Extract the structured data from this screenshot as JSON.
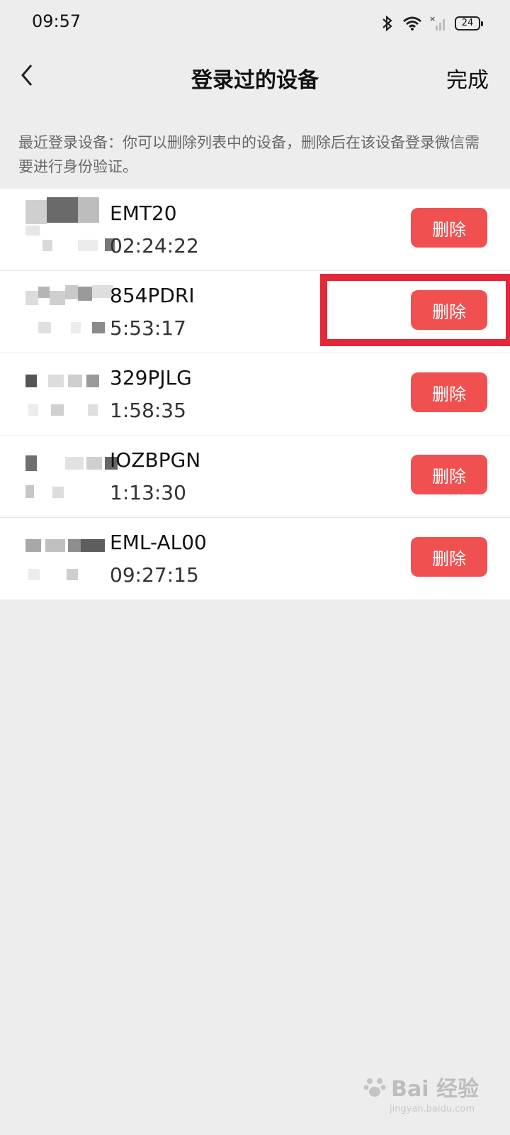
{
  "status_bar": {
    "time": "09:57",
    "battery": "24",
    "icons": [
      "bluetooth-icon",
      "wifi-icon",
      "cellular-signal-icon",
      "battery-icon"
    ]
  },
  "nav": {
    "back_icon": "chevron-left-icon",
    "title": "登录过的设备",
    "done_label": "完成"
  },
  "hint": "最近登录设备：你可以删除列表中的设备，删除后在该设备登录微信需要进行身份验证。",
  "devices": [
    {
      "name": "EMT20",
      "time": "02:24:22",
      "delete_label": "删除"
    },
    {
      "name": "854PDRI",
      "time": "5:53:17",
      "delete_label": "删除"
    },
    {
      "name": "329PJLG",
      "time": "1:58:35",
      "delete_label": "删除"
    },
    {
      "name": "IOZBPGN",
      "time": "1:13:30",
      "delete_label": "删除"
    },
    {
      "name": "EML-AL00",
      "time": "09:27:15",
      "delete_label": "删除"
    }
  ],
  "colors": {
    "delete_button": "#f05050",
    "highlight": "#e3283a",
    "background": "#ededed"
  },
  "watermark": {
    "text": "Bai 经验",
    "url": "jingyan.baidu.com"
  }
}
